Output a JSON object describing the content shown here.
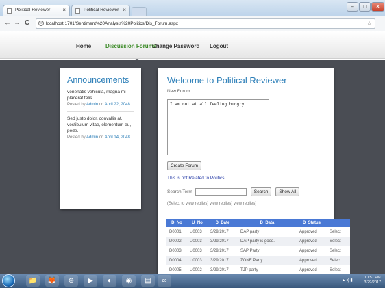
{
  "browser": {
    "tabs": [
      {
        "label": "Political Reviewer",
        "close": "×"
      },
      {
        "label": "Political Reviewer",
        "close": "×"
      }
    ],
    "window_controls": {
      "min": "–",
      "max": "□",
      "close": "×"
    },
    "nav": {
      "back": "←",
      "forward": "→",
      "reload": "C"
    },
    "url": "localhost:1701/Sentiment%20Analysis%20Politics/Dis_Forum.aspx",
    "star": "☆",
    "menu": "⋮"
  },
  "site_nav": {
    "home": "Home",
    "forums": "Discussion Forums",
    "change_password": "Change Password",
    "logout": "Logout"
  },
  "announcements": {
    "title": "Announcements",
    "items": [
      {
        "text": "venenatis vehicula, magna mi placerat felis.",
        "posted_by": "Posted by",
        "author": "Admin",
        "on": "on",
        "date": "April 22, 2048"
      },
      {
        "text": "Sed justo dolor, convallis at, vestibulum vitae, elementum eu, pede.",
        "posted_by": "Posted by",
        "author": "Admin",
        "on": "on",
        "date": "April 14, 2048"
      }
    ]
  },
  "forum": {
    "title": "Welcome to Political Reviewer",
    "subtitle": "New Forum",
    "textarea_value": "I am not at all feeling hungry...",
    "create_button": "Create Forum",
    "note": "This is not Related to Politics",
    "search_label": "Search Term",
    "search_value": "",
    "search_button": "Search",
    "show_all_button": "Show All",
    "hint": "(Select to view replies) view replies) view replies)"
  },
  "table": {
    "headers": [
      "D_No",
      "U_No",
      "D_Date",
      "D_Data",
      "D_Status",
      ""
    ],
    "rows": [
      [
        "D0001",
        "U0003",
        "3/29/2017",
        "DAP party",
        "Approved",
        "Select"
      ],
      [
        "D0002",
        "U0003",
        "3/29/2017",
        "DAP party is good..",
        "Approved",
        "Select"
      ],
      [
        "D0003",
        "U0003",
        "3/29/2017",
        "SAP Party",
        "Approved",
        "Select"
      ],
      [
        "D0004",
        "U0003",
        "3/29/2017",
        "ZONE Party.",
        "Approved",
        "Select"
      ],
      [
        "D0005",
        "U0002",
        "3/29/2017",
        "TJP party",
        "Approved",
        "Select"
      ]
    ]
  },
  "taskbar": {
    "icons": [
      "📁",
      "🦊",
      "⊛",
      "▶",
      "◐",
      "◉",
      "▤",
      "∞"
    ],
    "tray": "▴ ◂) ▮",
    "time": "10:57 PM",
    "date": "3/29/2017"
  },
  "colors": {
    "accent_blue": "#2d7fb8",
    "nav_active": "#3a8a25",
    "table_header": "#4a79d5",
    "background_dark": "#4a4d54"
  }
}
